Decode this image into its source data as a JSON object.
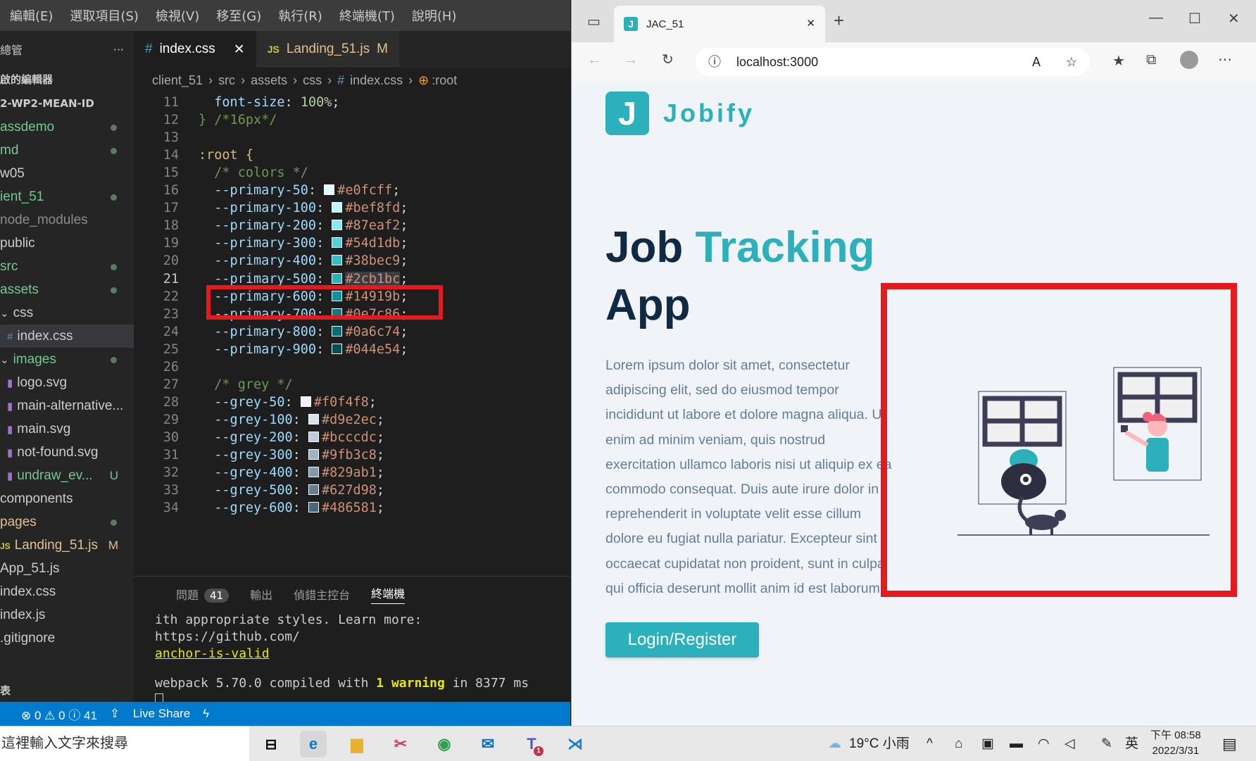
{
  "vscode": {
    "menu": [
      "編輯(E)",
      "選取項目(S)",
      "檢視(V)",
      "移至(G)",
      "執行(R)",
      "終端機(T)",
      "說明(H)"
    ],
    "explorer_title": "總管",
    "explorer_more": "···",
    "open_editors": "啟的編輯器",
    "workspace": "2-WP2-MEAN-ID",
    "tree": [
      {
        "label": "assdemo",
        "badge": "",
        "dot": true
      },
      {
        "label": "md",
        "badge": "",
        "dot": true
      },
      {
        "label": "w05",
        "badge": "",
        "dot": false
      },
      {
        "label": "ient_51",
        "badge": "",
        "dot": true
      },
      {
        "label": "node_modules",
        "badge": "",
        "dot": false
      },
      {
        "label": "public",
        "badge": "",
        "dot": false
      },
      {
        "label": "src",
        "badge": "",
        "dot": true
      },
      {
        "label": "assets",
        "badge": "",
        "dot": true
      },
      {
        "label": "css",
        "badge": "",
        "dot": false
      },
      {
        "label": "index.css",
        "badge": "",
        "dot": false
      },
      {
        "label": "images",
        "badge": "",
        "dot": true
      },
      {
        "label": "logo.svg",
        "badge": "",
        "dot": false
      },
      {
        "label": "main-alternative...",
        "badge": "",
        "dot": false
      },
      {
        "label": "main.svg",
        "badge": "",
        "dot": false
      },
      {
        "label": "not-found.svg",
        "badge": "",
        "dot": false
      },
      {
        "label": "undraw_ev...",
        "badge": "U",
        "dot": false
      },
      {
        "label": "components",
        "badge": "",
        "dot": false
      },
      {
        "label": "pages",
        "badge": "",
        "dot": true
      },
      {
        "label": "Landing_51.js",
        "badge": "M",
        "dot": false
      },
      {
        "label": "App_51.js",
        "badge": "",
        "dot": false
      },
      {
        "label": "index.css",
        "badge": "",
        "dot": false
      },
      {
        "label": "index.js",
        "badge": "",
        "dot": false
      },
      {
        "label": ".gitignore",
        "badge": "",
        "dot": false
      }
    ],
    "outline": "表",
    "tabs": [
      {
        "icon": "#",
        "label": "index.css",
        "close": "✕"
      },
      {
        "icon": "JS",
        "label": "Landing_51.js",
        "badge": "M"
      }
    ],
    "breadcrumb": [
      "client_51",
      "src",
      "assets",
      "css",
      "index.css",
      ":root"
    ],
    "code": [
      {
        "n": "11",
        "prop": "font-size",
        "value": "100%",
        "type": "decl-indent1"
      },
      {
        "n": "12",
        "text": "} /*16px*/",
        "type": "close-comment"
      },
      {
        "n": "13",
        "text": "",
        "type": "blank"
      },
      {
        "n": "14",
        "text": ":root {",
        "type": "selector"
      },
      {
        "n": "15",
        "text": "/* colors */",
        "type": "comment"
      },
      {
        "n": "16",
        "prop": "--primary-50",
        "value": "#e0fcff",
        "type": "color"
      },
      {
        "n": "17",
        "prop": "--primary-100",
        "value": "#bef8fd",
        "type": "color"
      },
      {
        "n": "18",
        "prop": "--primary-200",
        "value": "#87eaf2",
        "type": "color"
      },
      {
        "n": "19",
        "prop": "--primary-300",
        "value": "#54d1db",
        "type": "color"
      },
      {
        "n": "20",
        "prop": "--primary-400",
        "value": "#38bec9",
        "type": "color"
      },
      {
        "n": "21",
        "prop": "--primary-500",
        "value": "#2cb1bc",
        "type": "color",
        "highlight": true
      },
      {
        "n": "22",
        "prop": "--primary-600",
        "value": "#14919b",
        "type": "color"
      },
      {
        "n": "23",
        "prop": "--primary-700",
        "value": "#0e7c86",
        "type": "color"
      },
      {
        "n": "24",
        "prop": "--primary-800",
        "value": "#0a6c74",
        "type": "color"
      },
      {
        "n": "25",
        "prop": "--primary-900",
        "value": "#044e54",
        "type": "color"
      },
      {
        "n": "26",
        "text": "",
        "type": "blank"
      },
      {
        "n": "27",
        "text": "/* grey */",
        "type": "comment"
      },
      {
        "n": "28",
        "prop": "--grey-50",
        "value": "#f0f4f8",
        "type": "color"
      },
      {
        "n": "29",
        "prop": "--grey-100",
        "value": "#d9e2ec",
        "type": "color"
      },
      {
        "n": "30",
        "prop": "--grey-200",
        "value": "#bcccdc",
        "type": "color"
      },
      {
        "n": "31",
        "prop": "--grey-300",
        "value": "#9fb3c8",
        "type": "color"
      },
      {
        "n": "32",
        "prop": "--grey-400",
        "value": "#829ab1",
        "type": "color"
      },
      {
        "n": "33",
        "prop": "--grey-500",
        "value": "#627d98",
        "type": "color"
      },
      {
        "n": "34",
        "prop": "--grey-600",
        "value": "#486581",
        "type": "color"
      }
    ],
    "panel_tabs": {
      "problems": "問題",
      "problems_count": "41",
      "output": "輸出",
      "debug": "偵錯主控台",
      "terminal": "終端機"
    },
    "terminal": {
      "line1": "ith appropriate styles. Learn more: https://github.com/",
      "line2": "anchor-is-valid",
      "line3_a": "webpack 5.70.0 compiled with ",
      "line3_b": "1",
      "line3_c": " warning",
      "line3_d": " in 8377 ms"
    },
    "status": {
      "errors": "⊗ 0 ⚠ 0 ⓘ 41",
      "liveshare": "Live Share"
    }
  },
  "browser": {
    "tab_title": "JAC_51",
    "tab_close": "✕",
    "new_tab": "+",
    "url": "localhost:3000",
    "page": {
      "logo_letter": "J",
      "logo_text": "Jobify",
      "hero_word1": "Job",
      "hero_word2": "Tracking",
      "hero_word3": "App",
      "lorem": "Lorem ipsum dolor sit amet, consectetur adipiscing elit, sed do eiusmod tempor incididunt ut labore et dolore magna aliqua. Ut enim ad minim veniam, quis nostrud exercitation ullamco laboris nisi ut aliquip ex ea commodo consequat. Duis aute irure dolor in reprehenderit in voluptate velit esse cillum dolore eu fugiat nulla pariatur. Excepteur sint occaecat cupidatat non proident, sunt in culpa qui officia deserunt mollit anim id est laborum.",
      "button": "Login/Register"
    }
  },
  "taskbar": {
    "search_placeholder": "這裡輸入文字來搜尋",
    "weather": "19°C 小雨",
    "ime": "英",
    "time": "下午 08:58",
    "date": "2022/3/31",
    "teams_badge": "1"
  },
  "colors": {
    "accent": "#2cb1bc",
    "highlight_box": "#e51a1f",
    "statusbar": "#007acc",
    "heading": "#102a43"
  }
}
